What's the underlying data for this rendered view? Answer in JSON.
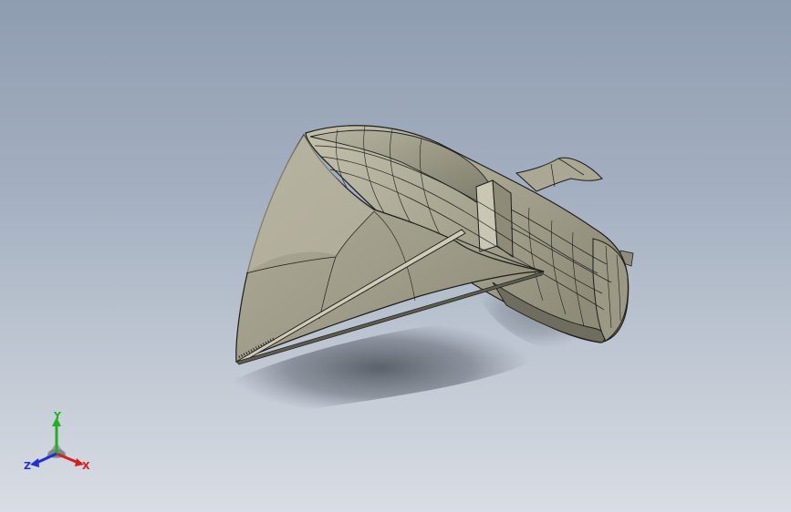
{
  "viewport": {
    "background_top": "#8f9db1",
    "background_bottom": "#d9dde4"
  },
  "model": {
    "body_color": "#a7a491",
    "shade_color": "#7b7968",
    "edge_color": "#1e1e1a"
  },
  "triad": {
    "x_label": "X",
    "y_label": "Y",
    "z_label": "Z",
    "x_color": "#d42020",
    "y_color": "#20b020",
    "z_color": "#2030d0"
  }
}
